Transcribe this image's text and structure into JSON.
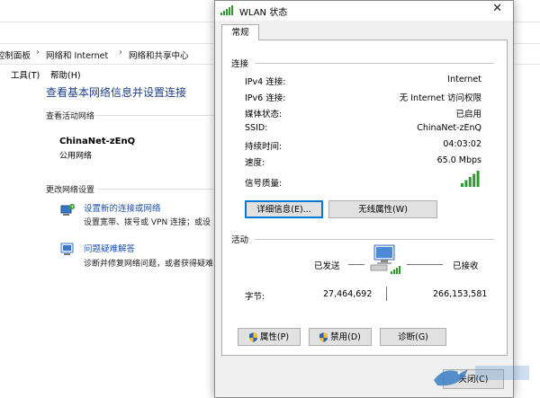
{
  "background_window": {
    "breadcrumb": [
      "控制面板",
      "网络和 Internet",
      "网络和共享中心"
    ],
    "menu": [
      "工具(T)",
      "帮助(H)"
    ],
    "title": "查看基本网络信息并设置连接",
    "active_networks_label": "查看活动网络",
    "network_name": "ChinaNet-zEnQ",
    "network_type": "公用网络",
    "change_settings_label": "更改网络设置",
    "tasks": [
      {
        "link": "设置新的连接或网络",
        "desc": "设置宽带、拨号或 VPN 连接；或设"
      },
      {
        "link": "问题疑难解答",
        "desc": "诊断并修复网络问题，或者获得疑难"
      }
    ]
  },
  "dialog": {
    "title": "WLAN 状态",
    "tab": "常规",
    "connection_label": "连接",
    "rows": [
      {
        "label": "IPv4 连接:",
        "value": "Internet"
      },
      {
        "label": "IPv6 连接:",
        "value": "无 Internet 访问权限"
      },
      {
        "label": "媒体状态:",
        "value": "已启用"
      },
      {
        "label": "SSID:",
        "value": "ChinaNet-zEnQ"
      },
      {
        "label": "持续时间:",
        "value": "04:03:02"
      },
      {
        "label": "速度:",
        "value": "65.0 Mbps"
      }
    ],
    "signal_label": "信号质量:",
    "signal_bars": 5,
    "details_button": "详细信息(E)...",
    "wireless_props_button": "无线属性(W)",
    "activity_label": "活动",
    "sent_label": "已发送",
    "received_label": "已接收",
    "bytes_label": "字节:",
    "bytes_sent": "27,464,692",
    "bytes_received": "266,153,581",
    "properties_button": "属性(P)",
    "disable_button": "禁用(D)",
    "diagnose_button": "诊断(G)",
    "close_button": "关闭(C)"
  },
  "colors": {
    "link": "#1a50b0",
    "title_blue": "#1e3f8a",
    "signal_green": "#2e9a2e",
    "focus_blue": "#0078d7"
  }
}
